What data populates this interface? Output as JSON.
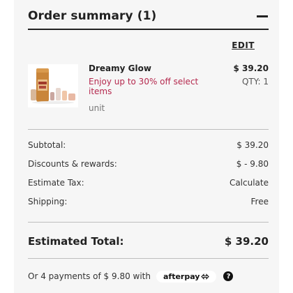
{
  "summary": {
    "title": "Order summary (1)",
    "edit_label": "EDIT"
  },
  "item": {
    "name": "Dreamy Glow",
    "promo": "Enjoy up to 30% off select items",
    "unit": "unit",
    "price": "$ 39.20",
    "qty": "QTY: 1"
  },
  "totals": {
    "subtotal_label": "Subtotal:",
    "subtotal_value": "$ 39.20",
    "discounts_label": "Discounts & rewards:",
    "discounts_value": "$ - 9.80",
    "tax_label": "Estimate Tax:",
    "tax_value": "Calculate",
    "shipping_label": "Shipping:",
    "shipping_value": "Free",
    "estimated_label": "Estimated Total:",
    "estimated_value": "$ 39.20"
  },
  "installments": {
    "text": "Or 4 payments of $ 9.80 with",
    "provider": "afterpay",
    "info_icon": "info-icon"
  }
}
